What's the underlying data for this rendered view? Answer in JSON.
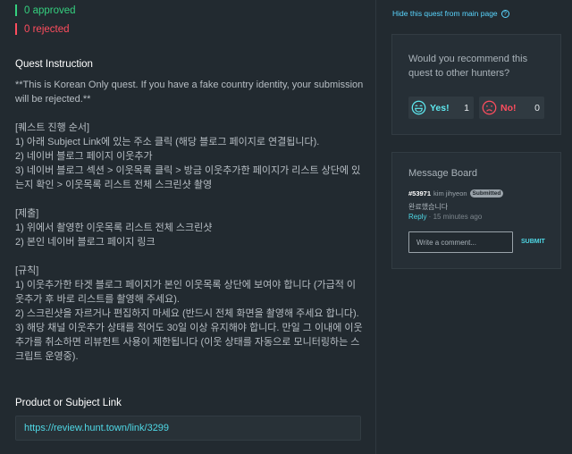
{
  "stats": {
    "approved": "0 approved",
    "rejected": "0 rejected"
  },
  "quest": {
    "instruction_title": "Quest Instruction",
    "intro": "**This is Korean Only quest. If you have a fake country identity, your submission will be rejected.**",
    "process_header": "[퀘스트 진행 순서]",
    "process_1": "1) 아래 Subject Link에 있는 주소 클릭 (해당 블로그 페이지로 연결됩니다).",
    "process_2": "2) 네이버 블로그 페이지 이웃추가",
    "process_3": "3) 네이버 블로그 섹션 > 이웃목록 클릭 > 방금 이웃추가한 페이지가 리스트 상단에 있는지 확인 > 이웃목록 리스트 전체 스크린샷 촬영",
    "submit_header": "[제출]",
    "submit_1": "1) 위에서 촬영한 이웃목록 리스트 전체 스크린샷",
    "submit_2": "2) 본인 네이버 블로그 페이지 링크",
    "rules_header": "[규칙]",
    "rules_1": "1) 이웃추가한 타겟 블로그 페이지가 본인 이웃목록 상단에 보여야 합니다 (가급적 이웃추가 후 바로 리스트를 촬영해 주세요).",
    "rules_2": "2) 스크린샷을 자르거나 편집하지 마세요 (반드시 전체 화면을 촬영해 주세요 합니다).",
    "rules_3": "3) 해당 채널 이웃추가 상태를 적어도 30일 이상 유지해야 합니다. 만일 그 이내에 이웃추가를 취소하면 리뷰헌트 사용이 제한됩니다 (이웃 상태를 자동으로 모니터링하는 스크립트 운영중).",
    "link_title": "Product or Subject Link",
    "link_url": "https://review.hunt.town/link/3299"
  },
  "sidebar": {
    "hide_link": "Hide this quest from main page",
    "hide_icon": "help-circle-icon",
    "recommend": {
      "question": "Would you recommend this quest to other hunters?",
      "yes_label": "Yes!",
      "yes_count": "1",
      "no_label": "No!",
      "no_count": "0"
    },
    "board": {
      "title": "Message Board",
      "message": {
        "id": "#53971",
        "user": "kim jihyeon",
        "badge": "Submitted",
        "text": "완료했습니다",
        "reply": "Reply",
        "time": " · 15 minutes ago"
      },
      "comment_placeholder": "Write a comment...",
      "submit": "SUBMIT"
    }
  },
  "colors": {
    "background": "#222a30",
    "approved": "#35d07f",
    "rejected": "#ff4d5e",
    "accent": "#4fd8e6"
  }
}
